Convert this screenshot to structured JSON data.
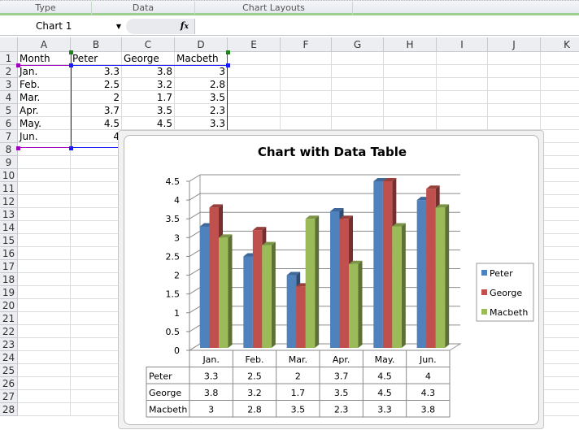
{
  "ribbon": {
    "groups": [
      "Type",
      "Data",
      "Chart Layouts"
    ]
  },
  "formula_bar": {
    "name_box": "Chart 1",
    "fx_label": "fx",
    "value": ""
  },
  "sheet": {
    "columns": [
      "A",
      "B",
      "C",
      "D",
      "E",
      "F",
      "G",
      "H",
      "I",
      "J",
      "K"
    ],
    "rows": [
      "1",
      "2",
      "3",
      "4",
      "5",
      "6",
      "7",
      "8",
      "9",
      "10",
      "11",
      "12",
      "13",
      "14",
      "15",
      "16",
      "17",
      "18",
      "19",
      "20",
      "21",
      "22",
      "23",
      "24",
      "25",
      "26",
      "27",
      "28"
    ],
    "header": [
      "Month",
      "Peter",
      "George",
      "Macbeth"
    ],
    "data": [
      [
        "Jan.",
        "3.3",
        "3.8",
        "3"
      ],
      [
        "Feb.",
        "2.5",
        "3.2",
        "2.8"
      ],
      [
        "Mar.",
        "2",
        "1.7",
        "3.5"
      ],
      [
        "Apr.",
        "3.7",
        "3.5",
        "2.3"
      ],
      [
        "May.",
        "4.5",
        "4.5",
        "3.3"
      ],
      [
        "Jun.",
        "4",
        "4.3",
        "3.8"
      ]
    ]
  },
  "chart_data": {
    "type": "bar",
    "title": "Chart with Data Table",
    "categories": [
      "Jan.",
      "Feb.",
      "Mar.",
      "Apr.",
      "May.",
      "Jun."
    ],
    "series": [
      {
        "name": "Peter",
        "values": [
          3.3,
          2.5,
          2,
          3.7,
          4.5,
          4
        ],
        "color": "#4f81bd"
      },
      {
        "name": "George",
        "values": [
          3.8,
          3.2,
          1.7,
          3.5,
          4.5,
          4.3
        ],
        "color": "#c0504d"
      },
      {
        "name": "Macbeth",
        "values": [
          3,
          2.8,
          3.5,
          2.3,
          3.3,
          3.8
        ],
        "color": "#9bbb59"
      }
    ],
    "ylim": [
      0,
      4.5
    ],
    "yticks": [
      "0",
      "0.5",
      "1",
      "1.5",
      "2",
      "2.5",
      "3",
      "3.5",
      "4",
      "4.5"
    ],
    "grid": true,
    "legend": "right",
    "style": "3d-clustered-column",
    "data_table": true
  }
}
